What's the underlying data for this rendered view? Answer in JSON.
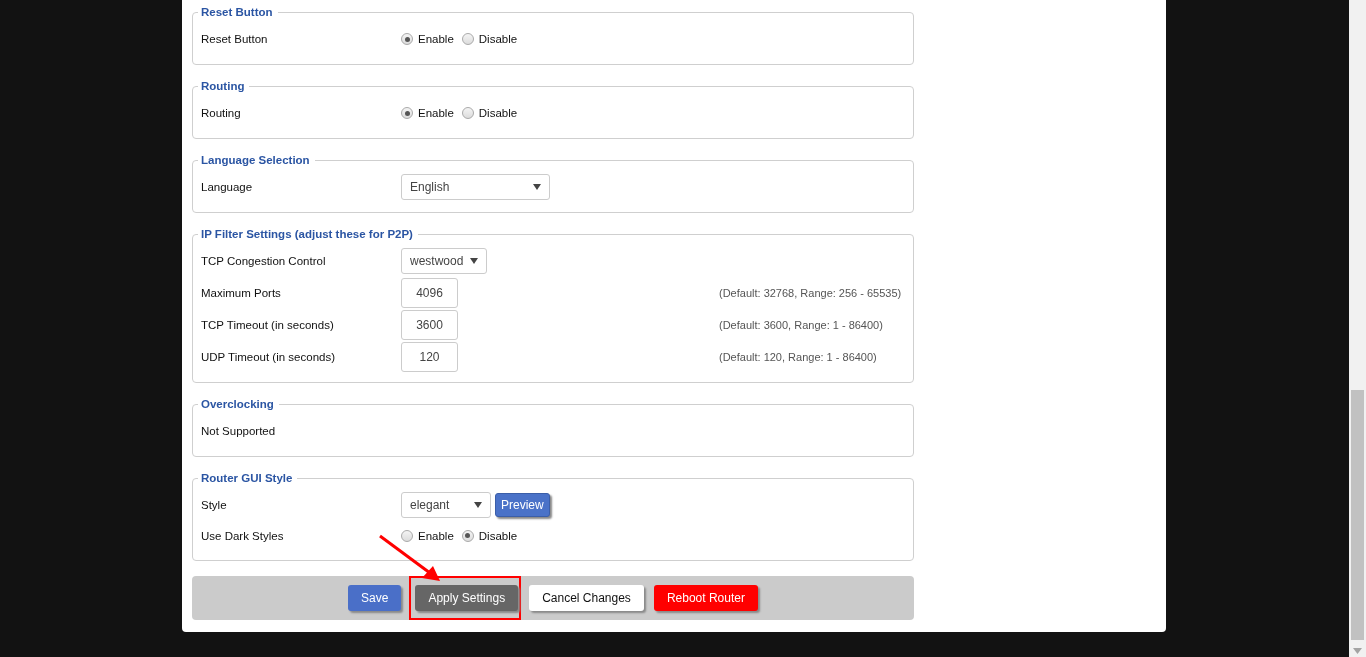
{
  "sections": [
    {
      "legend": "Reset Button",
      "rows": [
        {
          "kind": "radio",
          "label": "Reset Button",
          "options": [
            {
              "label": "Enable",
              "selected": true
            },
            {
              "label": "Disable",
              "selected": false
            }
          ]
        }
      ]
    },
    {
      "legend": "Routing",
      "rows": [
        {
          "kind": "radio",
          "label": "Routing",
          "options": [
            {
              "label": "Enable",
              "selected": true
            },
            {
              "label": "Disable",
              "selected": false
            }
          ]
        }
      ]
    },
    {
      "legend": "Language Selection",
      "rows": [
        {
          "kind": "select",
          "label": "Language",
          "value": "English"
        }
      ]
    },
    {
      "legend": "IP Filter Settings (adjust these for P2P)",
      "rows": [
        {
          "kind": "select",
          "label": "TCP Congestion Control",
          "value": "westwood"
        },
        {
          "kind": "input",
          "label": "Maximum Ports",
          "value": "4096",
          "hint": "(Default: 32768, Range: 256 - 65535)"
        },
        {
          "kind": "input",
          "label": "TCP Timeout (in seconds)",
          "value": "3600",
          "hint": "(Default: 3600, Range: 1 - 86400)"
        },
        {
          "kind": "input",
          "label": "UDP Timeout (in seconds)",
          "value": "120",
          "hint": "(Default: 120, Range: 1 - 86400)"
        }
      ]
    },
    {
      "legend": "Overclocking",
      "rows": [
        {
          "kind": "text",
          "label": "Not Supported"
        }
      ]
    },
    {
      "legend": "Router GUI Style",
      "rows": [
        {
          "kind": "select",
          "label": "Style",
          "value": "elegant",
          "button": "Preview"
        },
        {
          "kind": "radio",
          "label": "Use Dark Styles",
          "options": [
            {
              "label": "Enable",
              "selected": false
            },
            {
              "label": "Disable",
              "selected": true
            }
          ]
        }
      ]
    }
  ],
  "buttons": [
    {
      "label": "Save",
      "kind": "primary",
      "highlighted": false
    },
    {
      "label": "Apply Settings",
      "kind": "apply",
      "highlighted": true
    },
    {
      "label": "Cancel Changes",
      "kind": "plain",
      "highlighted": false
    },
    {
      "label": "Reboot Router",
      "kind": "danger",
      "highlighted": false
    }
  ]
}
